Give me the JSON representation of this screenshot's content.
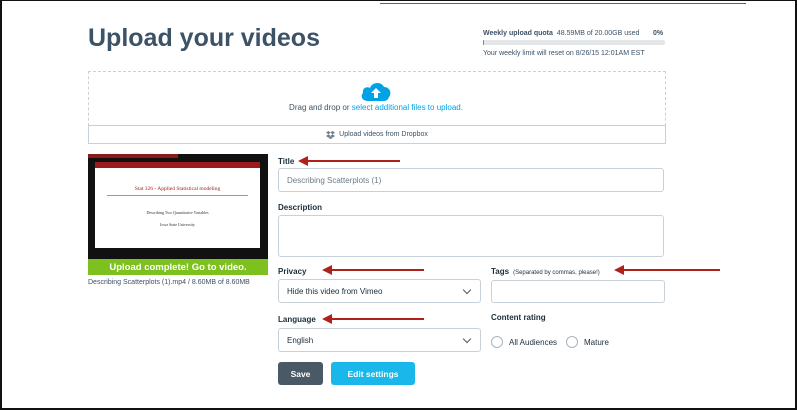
{
  "page": {
    "title": "Upload your videos"
  },
  "quota": {
    "label": "Weekly upload quota",
    "used": "48.59MB of 20.00GB used",
    "percent": "0%",
    "fill_fraction": 0.0024,
    "reset_text": "Your weekly limit will reset on 8/26/15 12:01AM EST"
  },
  "dropzone": {
    "prefix": "Drag and drop or",
    "link": "select additional files to upload.",
    "dropbox_label": "Upload videos from Dropbox",
    "accent": "#00a2e6"
  },
  "video": {
    "slide_title": "Stat 326 - Applied Statistical modeling",
    "slide_subtitle": "Describing Two Quantitative Variables",
    "slide_institution": "Iowa State University",
    "upload_status": "Upload complete! Go to video.",
    "file_info": "Describing Scatterplots (1).mp4 / 8.60MB of 8.60MB",
    "status_color": "#7dc11f"
  },
  "form": {
    "title_label": "Title",
    "title_value": "Describing Scatterplots (1)",
    "description_label": "Description",
    "description_value": "",
    "privacy_label": "Privacy",
    "privacy_value": "Hide this video from Vimeo",
    "tags_label": "Tags",
    "tags_hint": "(Separated by commas, please!)",
    "tags_value": "",
    "language_label": "Language",
    "language_value": "English",
    "content_rating_label": "Content rating",
    "rating_options": [
      "All Audiences",
      "Mature"
    ]
  },
  "actions": {
    "save": "Save",
    "edit": "Edit settings"
  },
  "icons": [
    "upload-cloud-icon",
    "dropbox-icon",
    "chevron-down-icon",
    "annotation-arrow-icon"
  ]
}
